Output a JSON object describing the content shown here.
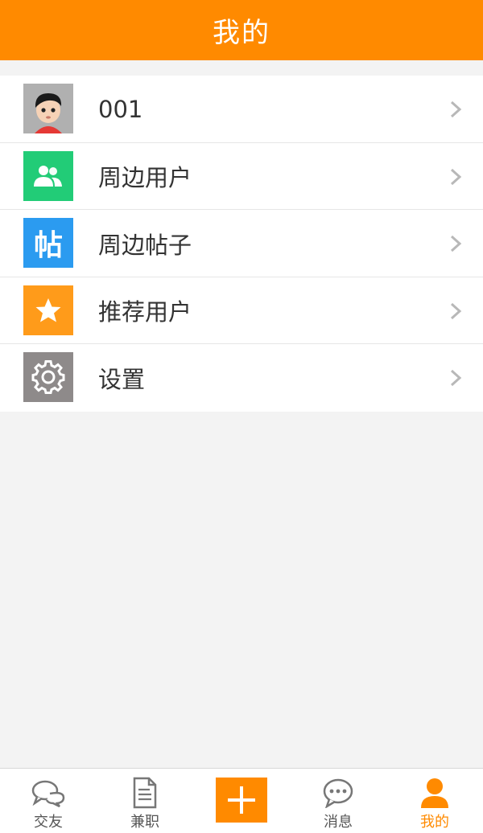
{
  "header": {
    "title": "我的"
  },
  "menu": {
    "items": [
      {
        "label": "001",
        "icon": "user-avatar",
        "color": "#9e9e9e"
      },
      {
        "label": "周边用户",
        "icon": "people-icon",
        "color": "#22cc77"
      },
      {
        "label": "周边帖子",
        "icon": "post-icon",
        "icon_text": "帖",
        "color": "#2b9bf0"
      },
      {
        "label": "推荐用户",
        "icon": "star-icon",
        "color": "#ff9b1a"
      },
      {
        "label": "设置",
        "icon": "gear-icon",
        "color": "#8e8a8a"
      }
    ]
  },
  "tabbar": {
    "accent": "#ff8a00",
    "tabs": [
      {
        "label": "交友",
        "icon": "chat-bubbles-icon",
        "active": false
      },
      {
        "label": "兼职",
        "icon": "document-icon",
        "active": false
      },
      {
        "label": "",
        "icon": "plus-icon",
        "active": false
      },
      {
        "label": "消息",
        "icon": "message-icon",
        "active": false
      },
      {
        "label": "我的",
        "icon": "person-icon",
        "active": true
      }
    ]
  }
}
